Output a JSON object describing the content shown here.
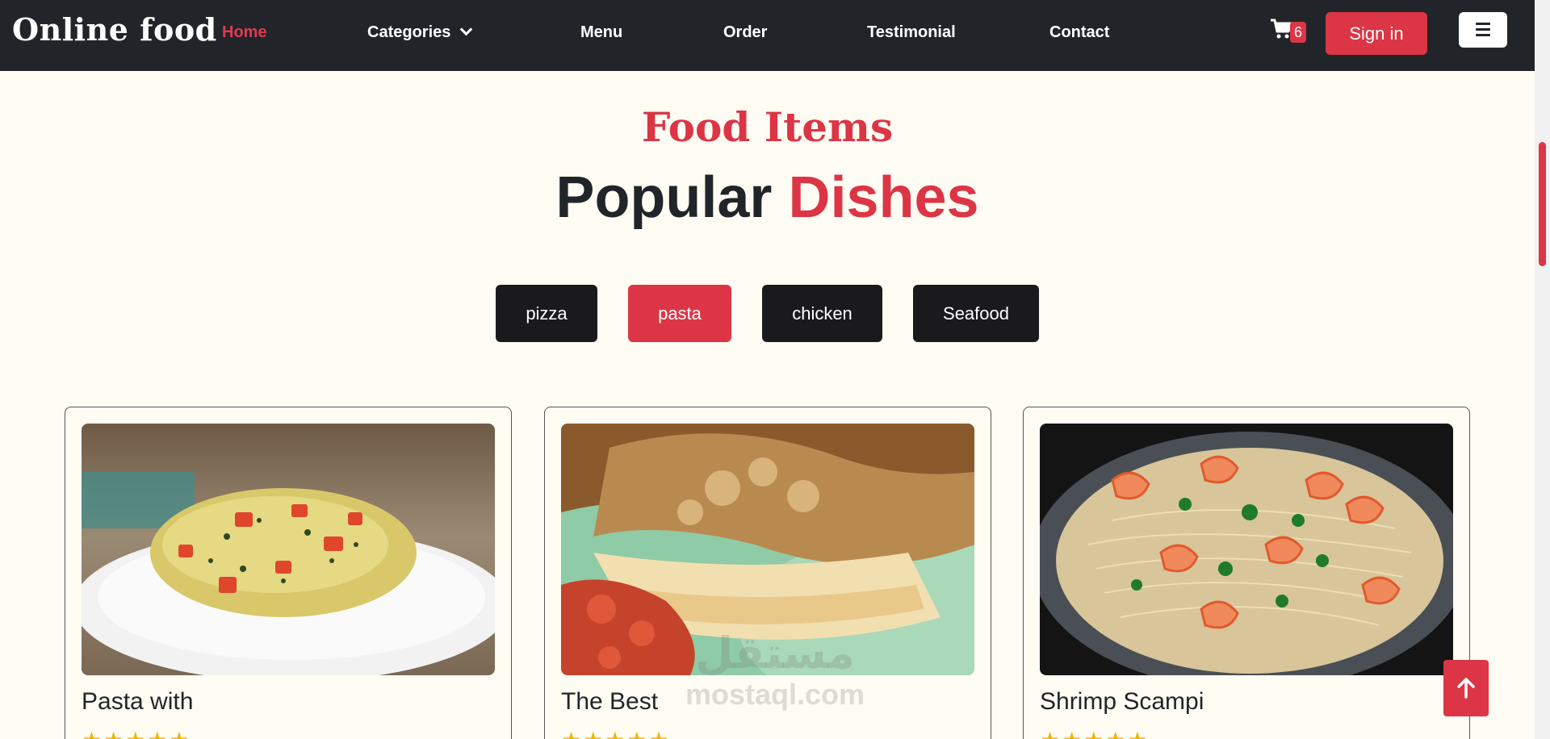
{
  "navbar": {
    "brand": "Online food",
    "links": [
      "Home",
      "Categories",
      "Menu",
      "Order",
      "Testimonial",
      "Contact"
    ],
    "active": "Home",
    "cart_count": "6",
    "signin_label": "Sign in"
  },
  "section": {
    "subtitle": "Food Items",
    "title_main": "Popular",
    "title_accent": "Dishes"
  },
  "filters": {
    "items": [
      "pizza",
      "pasta",
      "chicken",
      "Seafood"
    ],
    "active": "pasta"
  },
  "cards": [
    {
      "title": "Pasta with",
      "rating": 5
    },
    {
      "title": "The Best",
      "rating": 5
    },
    {
      "title": "Shrimp Scampi",
      "rating": 5
    }
  ],
  "watermark": {
    "arabic": "مستقل",
    "latin": "mostaql.com"
  },
  "colors": {
    "accent": "#dc3545",
    "navbar": "#212529",
    "background": "#fffcf3",
    "star": "#f5b301"
  }
}
